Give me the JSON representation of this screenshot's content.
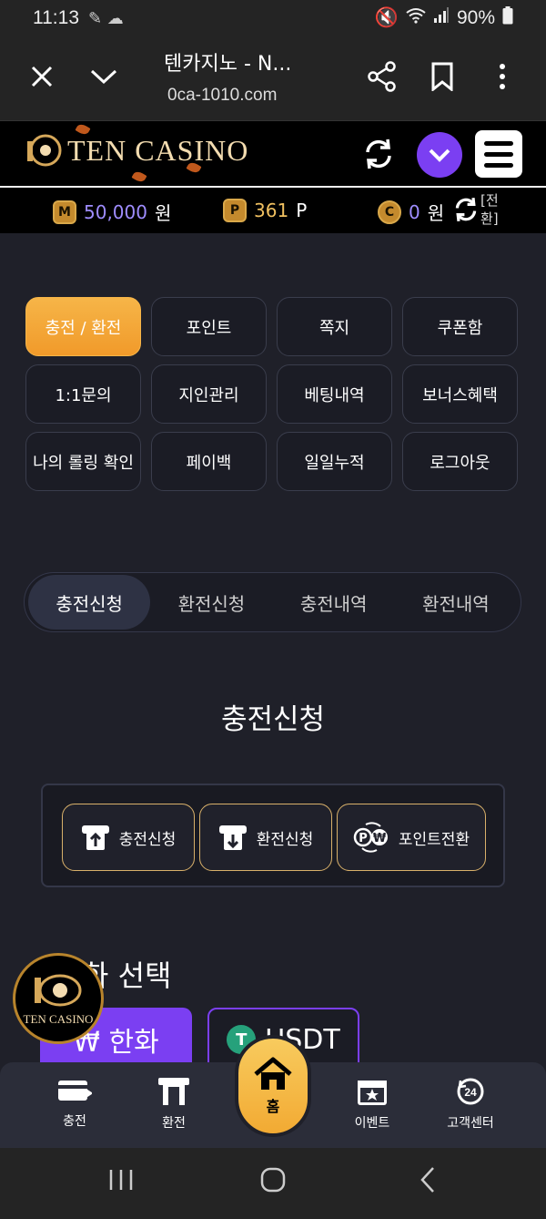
{
  "status_bar": {
    "time": "11:13",
    "battery": "90%"
  },
  "browser": {
    "title": "텐카지노 - N...",
    "url": "0ca-1010.com"
  },
  "site": {
    "logo_text": "TEN CASINO"
  },
  "balances": {
    "money_icon": "M",
    "money_value": "50,000",
    "money_unit": "원",
    "point_icon": "P",
    "point_value": "361",
    "point_unit": "P",
    "coin_icon": "C",
    "coin_value": "0",
    "coin_unit": "원",
    "convert_label_1": "[전",
    "convert_label_2": "환]"
  },
  "menu": {
    "items": [
      {
        "label": "충전 / 환전",
        "active": true
      },
      {
        "label": "포인트"
      },
      {
        "label": "쪽지"
      },
      {
        "label": "쿠폰함"
      },
      {
        "label": "1:1문의"
      },
      {
        "label": "지인관리"
      },
      {
        "label": "베팅내역"
      },
      {
        "label": "보너스혜택"
      },
      {
        "label": "나의 롤링 확인"
      },
      {
        "label": "페이백"
      },
      {
        "label": "일일누적"
      },
      {
        "label": "로그아웃"
      }
    ]
  },
  "tabs": [
    {
      "label": "충전신청",
      "active": true
    },
    {
      "label": "환전신청"
    },
    {
      "label": "충전내역"
    },
    {
      "label": "환전내역"
    }
  ],
  "section_title": "충전신청",
  "actions": {
    "deposit": "충전신청",
    "withdraw": "환전신청",
    "point_convert": "포인트전환"
  },
  "currency": {
    "title_visible": "화 선택",
    "krw_label": "₩ 한화",
    "usdt_label": "USDT",
    "usdt_icon": "T"
  },
  "float_logo_text": "TEN CASINO",
  "bottom_nav": {
    "deposit": "충전",
    "withdraw": "환전",
    "home": "홈",
    "event": "이벤트",
    "support": "고객센터",
    "support_badge": "24"
  },
  "colors": {
    "accent_purple": "#7b3ff2",
    "accent_orange": "#f6b548",
    "background": "#1f2029"
  }
}
